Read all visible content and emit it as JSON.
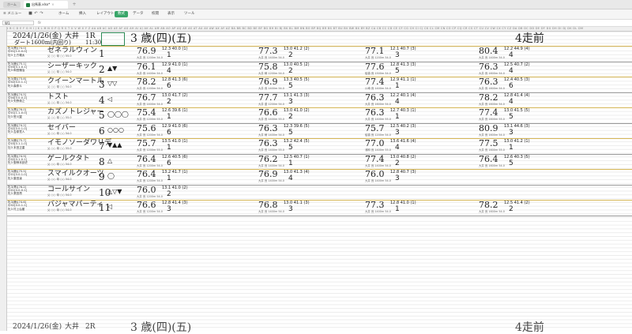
{
  "window": {
    "home_tab": "ホーム",
    "doc_tab": "出馬表.xlsx*",
    "close_glyph": "×",
    "add_glyph": "+"
  },
  "ribbon": {
    "menu": "≡ メニュー",
    "tabs": [
      {
        "label": "ホーム",
        "active": false
      },
      {
        "label": "挿入",
        "active": false
      },
      {
        "label": "レイアウト",
        "active": false
      },
      {
        "label": "数式",
        "active": true
      },
      {
        "label": "データ",
        "active": false
      },
      {
        "label": "校閲",
        "active": false
      },
      {
        "label": "表示",
        "active": false
      },
      {
        "label": "ツール",
        "active": false
      }
    ]
  },
  "formula": {
    "cell_ref": "W1",
    "fx": "fx"
  },
  "columns_header": "A B C D E F G H I J K L M N O P Q R S T U V W X Y Z AA AB AC AD AE AF AG AH AI AJ AK AL AM AN AO AP AQ AR AS AT AU AV AW AX AY AZ BA BB BC BD BE BF BG BH BI BJ BK BL BM BN BO BP BQ BR BS BT BU BV BW BX BY BZ CA CB CC CD CE CF CG CH CI CJ CK CL CM CN CO CP CQ CR CS CT CU CV CW CX CY CZ DA DB DC DD DE DF DG DH DI DJ DK DL DM",
  "race_header": {
    "date": "2024/1/26(金)",
    "venue": "大井",
    "race_no": "1R",
    "course": "ダート1600m(内回り)",
    "time": "11:30",
    "class": "3 歳(四)(五)",
    "prev_label": "4走前"
  },
  "horses": [
    {
      "info": [
        "牝3(黒)[74.0]",
        "中01[1-0-0-0]",
        "牡3 土方颯太"
      ],
      "name": "ゼネラルウィン",
      "sub": "父 ○○ 母 ○○ 55.0",
      "num": "1",
      "mark": "",
      "races": [
        {
          "rating": "76.9",
          "pos": "12.3  40.0  (1)",
          "fin": "1",
          "det": "大井 良 1200m  54.0"
        },
        {
          "rating": "77.3",
          "pos": "13.0  41.2  (2)",
          "fin": "2",
          "det": "大井 良 1400m  54.0"
        },
        {
          "rating": "77.1",
          "pos": "12.1  40.7  (3)",
          "fin": "3",
          "det": "大井 良 1200m  54.0"
        },
        {
          "rating": "80.4",
          "pos": "12.2  44.9  (4)",
          "fin": "4",
          "det": "大井 良 1400m  54.0"
        }
      ]
    },
    {
      "info": [
        "牝3(鹿)[75.1]",
        "中03[0-1-0-1]",
        "牝3 和田譲治"
      ],
      "name": "シーザーキック",
      "sub": "父 ○○ 母 ○○ 54.0",
      "num": "2",
      "mark": "▲▼",
      "races": [
        {
          "rating": "76.1",
          "pos": "12.9  41.0  (1)",
          "fin": "4",
          "det": "大井 良 1400m  54.0"
        },
        {
          "rating": "75.8",
          "pos": "13.0  40.5  (2)",
          "fin": "2",
          "det": "大井 稍 1200m  54.0"
        },
        {
          "rating": "77.6",
          "pos": "12.8  41.3  (3)",
          "fin": "5",
          "det": "船橋 良 1500m  54.0"
        },
        {
          "rating": "76.3",
          "pos": "12.5  40.7  (2)",
          "fin": "4",
          "det": "大井 良 1600m  54.0"
        }
      ]
    },
    {
      "info": [
        "牝3(栗)[73.8]",
        "中02[0-0-1-1]",
        "牝3 森泰斗"
      ],
      "name": "クイーンマートル",
      "sub": "父 ○○ 母 ○○ 54.0",
      "num": "3",
      "mark": "▽▽",
      "races": [
        {
          "rating": "78.2",
          "pos": "12.8  41.3  (6)",
          "fin": "6",
          "det": "大井 良 1200m  54.0"
        },
        {
          "rating": "76.9",
          "pos": "13.3  40.5  (5)",
          "fin": "5",
          "det": "大井 良 1400m  54.0"
        },
        {
          "rating": "77.4",
          "pos": "12.9  41.1  (1)",
          "fin": "1",
          "det": "川崎 良 1400m  54.0"
        },
        {
          "rating": "76.3",
          "pos": "12.4  40.5  (3)",
          "fin": "6",
          "det": "大井 良 1600m  54.0"
        }
      ]
    },
    {
      "info": [
        "牝3(鹿)[74.5]",
        "中04[0-0-0-2]",
        "牝3 矢野貴之"
      ],
      "name": "トスト",
      "sub": "父 ○○ 母 ○○ 54.0",
      "num": "4",
      "mark": "◁",
      "races": [
        {
          "rating": "76.7",
          "pos": "13.0  41.7  (2)",
          "fin": "2",
          "det": "大井 良 1400m  54.0"
        },
        {
          "rating": "77.7",
          "pos": "13.1  41.3  (3)",
          "fin": "3",
          "det": "大井 重 1200m  54.0"
        },
        {
          "rating": "76.3",
          "pos": "12.2  40.1  (4)",
          "fin": "4",
          "det": "大井 良 1600m  54.0"
        },
        {
          "rating": "78.2",
          "pos": "12.8  41.4  (4)",
          "fin": "4",
          "det": "大井 良 1600m  54.0"
        }
      ]
    },
    {
      "info": [
        "牝3(黒)[76.0]",
        "中01[1-1-0-0]",
        "牡3 笹川翼"
      ],
      "name": "カズノトレジャー",
      "sub": "父 ○○ 母 ○○ 55.0",
      "num": "5",
      "mark": "◯◯◯",
      "races": [
        {
          "rating": "75.4",
          "pos": "12.6  39.6  (1)",
          "fin": "1",
          "det": "大井 良 1200m  55.0"
        },
        {
          "rating": "76.6",
          "pos": "13.0  41.0  (2)",
          "fin": "2",
          "det": "大井 良 1400m  55.0"
        },
        {
          "rating": "76.3",
          "pos": "12.7  40.3  (1)",
          "fin": "1",
          "det": "大井 良 1400m  55.0"
        },
        {
          "rating": "77.4",
          "pos": "13.0  41.5  (5)",
          "fin": "5",
          "det": "大井 良 1600m  55.0"
        }
      ]
    },
    {
      "info": [
        "牝3(鹿)[74.2]",
        "中02[0-0-1-0]",
        "牝3 吉原寛人"
      ],
      "name": "セイバー",
      "sub": "父 ○○ 母 ○○ 54.0",
      "num": "6",
      "mark": "○○○",
      "races": [
        {
          "rating": "75.6",
          "pos": "12.9  41.0  (6)",
          "fin": "6",
          "det": "大井 良 1200m  54.0"
        },
        {
          "rating": "76.3",
          "pos": "12.3  39.6  (5)",
          "fin": "5",
          "det": "大井 稍 1400m  54.0"
        },
        {
          "rating": "75.7",
          "pos": "12.5  40.2  (3)",
          "fin": "3",
          "det": "船橋 良 1200m  54.0"
        },
        {
          "rating": "80.9",
          "pos": "13.1  44.6  (3)",
          "fin": "3",
          "det": "大井 良 1600m  54.0"
        }
      ]
    },
    {
      "info": [
        "牝3(鹿)[75.7]",
        "中03[0-1-1-0]",
        "牡3 本田正重"
      ],
      "name": "イモノソーダワリデ",
      "sub": "父 ○○ 母 ○○ 55.0",
      "num": "7",
      "mark": "▼▲▲",
      "races": [
        {
          "rating": "75.7",
          "pos": "13.5  41.0  (1)",
          "fin": "1",
          "det": "大井 良 1200m  55.0"
        },
        {
          "rating": "76.3",
          "pos": "13.2  42.4  (5)",
          "fin": "5",
          "det": "大井 良 1400m  55.0"
        },
        {
          "rating": "77.0",
          "pos": "13.6  41.6  (4)",
          "fin": "4",
          "det": "浦和 良 1400m  55.0"
        },
        {
          "rating": "77.5",
          "pos": "13.0  41.2  (1)",
          "fin": "1",
          "det": "大井 良 1600m  55.0"
        }
      ]
    },
    {
      "info": [
        "牝3(栗)[74.9]",
        "中02[0-1-0-1]",
        "牝3 御神本訓史"
      ],
      "name": "ゲールクタト",
      "sub": "父 ○○ 母 ○○ 54.0",
      "num": "8",
      "mark": "△",
      "races": [
        {
          "rating": "76.4",
          "pos": "12.6  40.5  (6)",
          "fin": "6",
          "det": "大井 良 1200m  54.0"
        },
        {
          "rating": "76.2",
          "pos": "12.5  40.7  (1)",
          "fin": "1",
          "det": "大井 良 1400m  54.0"
        },
        {
          "rating": "77.4",
          "pos": "13.0  40.8  (2)",
          "fin": "2",
          "det": "大井 良 1400m  54.0"
        },
        {
          "rating": "76.4",
          "pos": "12.6  40.3  (5)",
          "fin": "5",
          "det": "大井 良 1600m  54.0"
        }
      ]
    },
    {
      "info": [
        "牝3(鹿)[75.5]",
        "中01[0-0-1-0]",
        "牝3 藤田凌"
      ],
      "name": "スマイルクオーツ",
      "sub": "父 ○○ 母 ○○ 54.0",
      "num": "9",
      "mark": "◯",
      "races": [
        {
          "rating": "76.4",
          "pos": "13.2  41.7  (1)",
          "fin": "1",
          "det": "大井 良 1200m  54.0"
        },
        {
          "rating": "76.9",
          "pos": "13.0  41.3  (4)",
          "fin": "4",
          "det": "大井 良 1400m  54.0"
        },
        {
          "rating": "76.0",
          "pos": "12.8  40.7  (3)",
          "fin": "3",
          "det": "大井 良 1400m  54.0"
        },
        {
          "rating": "",
          "pos": "",
          "fin": "",
          "det": ""
        }
      ]
    },
    {
      "info": [
        "牝3(青)[76.2]",
        "中01[0-0-0-1]",
        "牝3 張田昂"
      ],
      "name": "コールサイン",
      "sub": "父 ○○ 母 ○○ 54.0",
      "num": "10",
      "mark": "△▽▼",
      "races": [
        {
          "rating": "76.0",
          "pos": "13.1  41.0  (2)",
          "fin": "2",
          "det": "大井 良 1200m  54.0"
        },
        {
          "rating": "",
          "pos": "",
          "fin": "",
          "det": ""
        },
        {
          "rating": "",
          "pos": "",
          "fin": "",
          "det": ""
        },
        {
          "rating": "",
          "pos": "",
          "fin": "",
          "det": ""
        }
      ]
    },
    {
      "info": [
        "牝3(鹿)[74.6]",
        "中02[0-0-1-1]",
        "牝3 村上弘樹"
      ],
      "name": "バジャマパーティ",
      "sub": "父 ○○ 母 ○○ 54.0",
      "num": "11",
      "mark": "◁",
      "races": [
        {
          "rating": "76.6",
          "pos": "12.8  41.4  (3)",
          "fin": "3",
          "det": "大井 良 1200m  54.0"
        },
        {
          "rating": "76.8",
          "pos": "13.0  41.1  (3)",
          "fin": "3",
          "det": "大井 良 1400m  54.0"
        },
        {
          "rating": "77.3",
          "pos": "12.8  41.0  (1)",
          "fin": "1",
          "det": "大井 良 1400m  54.0"
        },
        {
          "rating": "78.2",
          "pos": "12.5  41.4  (2)",
          "fin": "2",
          "det": "大井 良 1600m  54.0"
        }
      ]
    }
  ],
  "next_header": {
    "date": "2024/1/26(金)",
    "venue": "大井",
    "race_no": "2R",
    "class": "3 歳(四)(五)",
    "prev_label": "4走前"
  }
}
